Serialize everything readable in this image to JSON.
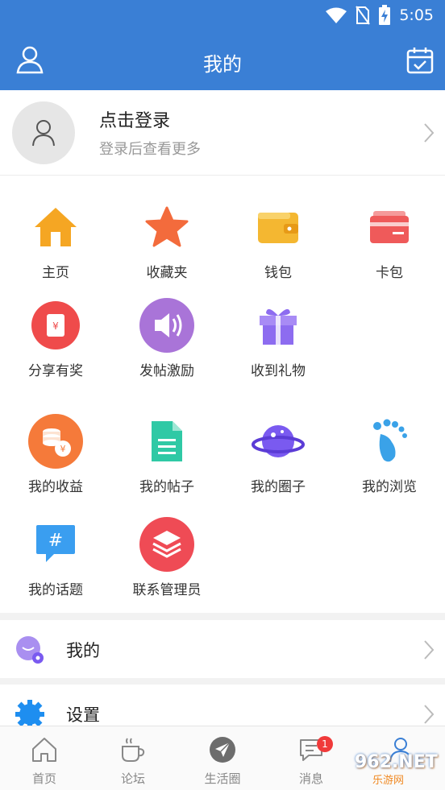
{
  "status": {
    "time": "5:05"
  },
  "appbar": {
    "title": "我的",
    "left_icon": "user-icon",
    "right_icon": "calendar-check-icon"
  },
  "profile": {
    "title": "点击登录",
    "subtitle": "登录后查看更多"
  },
  "grid": [
    {
      "label": "主页",
      "icon": "home-icon",
      "color": "#f5a623"
    },
    {
      "label": "收藏夹",
      "icon": "star-icon",
      "color": "#f36b3c"
    },
    {
      "label": "钱包",
      "icon": "wallet-icon",
      "color": "#f4b731"
    },
    {
      "label": "卡包",
      "icon": "card-icon",
      "color": "#ef5a5a"
    },
    {
      "label": "分享有奖",
      "icon": "red-envelope-icon",
      "color": "#ef4b4b"
    },
    {
      "label": "发帖激励",
      "icon": "speaker-icon",
      "color": "#a974d8"
    },
    {
      "label": "收到礼物",
      "icon": "gift-icon",
      "color": "#8d6cf0"
    },
    {
      "label": "我的收益",
      "icon": "coins-icon",
      "color": "#f57a3a"
    },
    {
      "label": "我的帖子",
      "icon": "document-icon",
      "color": "#2fc9a5"
    },
    {
      "label": "我的圈子",
      "icon": "planet-icon",
      "color": "#7a5af0"
    },
    {
      "label": "我的浏览",
      "icon": "footprint-icon",
      "color": "#3aa2e8"
    },
    {
      "label": "我的话题",
      "icon": "hashtag-icon",
      "color": "#3a9ef0"
    },
    {
      "label": "联系管理员",
      "icon": "layers-icon",
      "color": "#ef4b55"
    }
  ],
  "menu": [
    {
      "label": "我的",
      "icon": "my-avatar-icon"
    },
    {
      "label": "设置",
      "icon": "settings-gear-icon"
    }
  ],
  "tabs": [
    {
      "label": "首页",
      "icon": "home-outline-icon"
    },
    {
      "label": "论坛",
      "icon": "coffee-cup-icon"
    },
    {
      "label": "生活圈",
      "icon": "paper-plane-icon"
    },
    {
      "label": "消息",
      "icon": "chat-bubble-icon",
      "badge": "1"
    },
    {
      "label": "",
      "icon": "person-tab-icon"
    }
  ],
  "watermark": {
    "text": "962.NET",
    "sub": "乐游网"
  },
  "colors": {
    "primary": "#3a7fd5",
    "badge": "#f03a3a"
  }
}
